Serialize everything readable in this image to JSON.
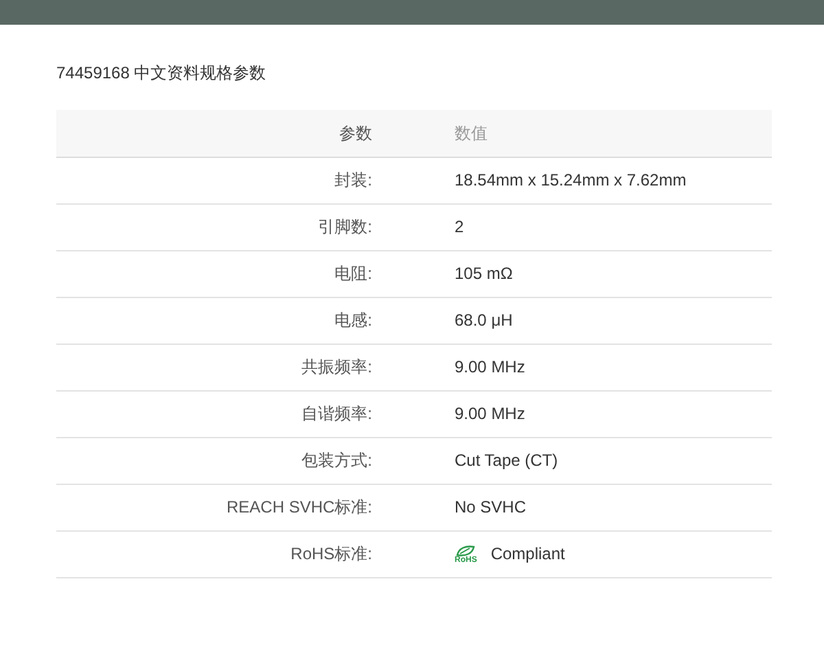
{
  "title": "74459168 中文资料规格参数",
  "table": {
    "columns": [
      "参数",
      "数值"
    ],
    "rows": [
      {
        "label": "封装:",
        "value": "18.54mm x 15.24mm x 7.62mm"
      },
      {
        "label": "引脚数:",
        "value": "2"
      },
      {
        "label": "电阻:",
        "value": "105 mΩ"
      },
      {
        "label": "电感:",
        "value": "68.0 μH"
      },
      {
        "label": "共振频率:",
        "value": "9.00 MHz"
      },
      {
        "label": "自谐频率:",
        "value": "9.00 MHz"
      },
      {
        "label": "包装方式:",
        "value": "Cut Tape (CT)"
      },
      {
        "label": "REACH SVHC标准:",
        "value": "No SVHC"
      },
      {
        "label": "RoHS标准:",
        "value": "Compliant",
        "kind": "rohs",
        "logo_text": "RoHS"
      }
    ]
  }
}
